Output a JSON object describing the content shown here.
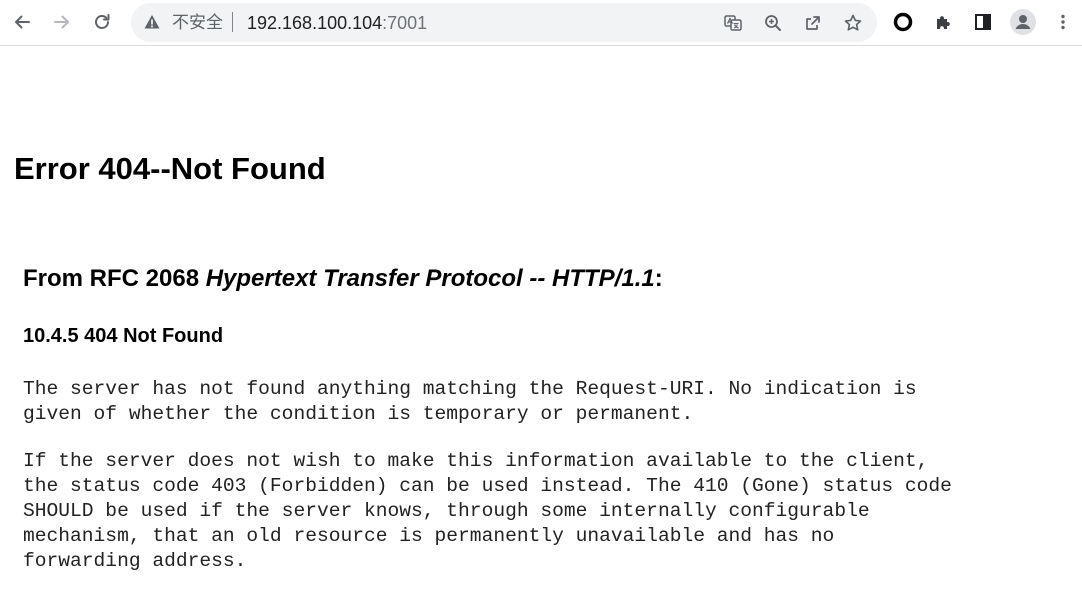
{
  "browser": {
    "security_label": "不安全",
    "url_host": "192.168.100.104",
    "url_port": ":7001"
  },
  "page": {
    "title": "Error 404--Not Found",
    "rfc_heading": {
      "prefix": "From RFC 2068 ",
      "italic": "Hypertext Transfer Protocol -- HTTP/1.1",
      "suffix": ":"
    },
    "section_heading": "10.4.5 404 Not Found",
    "paragraph1": "The server has not found anything matching the Request-URI. No indication is\ngiven of whether the condition is temporary or permanent.",
    "paragraph2": "If the server does not wish to make this information available to the client,\nthe status code 403 (Forbidden) can be used instead. The 410 (Gone) status code\nSHOULD be used if the server knows, through some internally configurable\nmechanism, that an old resource is permanently unavailable and has no\nforwarding address."
  },
  "icons": {
    "back": "back-arrow-icon",
    "forward": "forward-arrow-icon",
    "reload": "reload-icon",
    "warning": "warning-triangle-icon",
    "translate": "translate-icon",
    "zoom": "zoom-icon",
    "share": "share-icon",
    "bookmark": "star-icon",
    "extension_ring": "ring-icon",
    "extensions": "puzzle-icon",
    "side_panel": "side-panel-icon",
    "profile": "avatar-icon",
    "menu": "kebab-menu-icon"
  }
}
